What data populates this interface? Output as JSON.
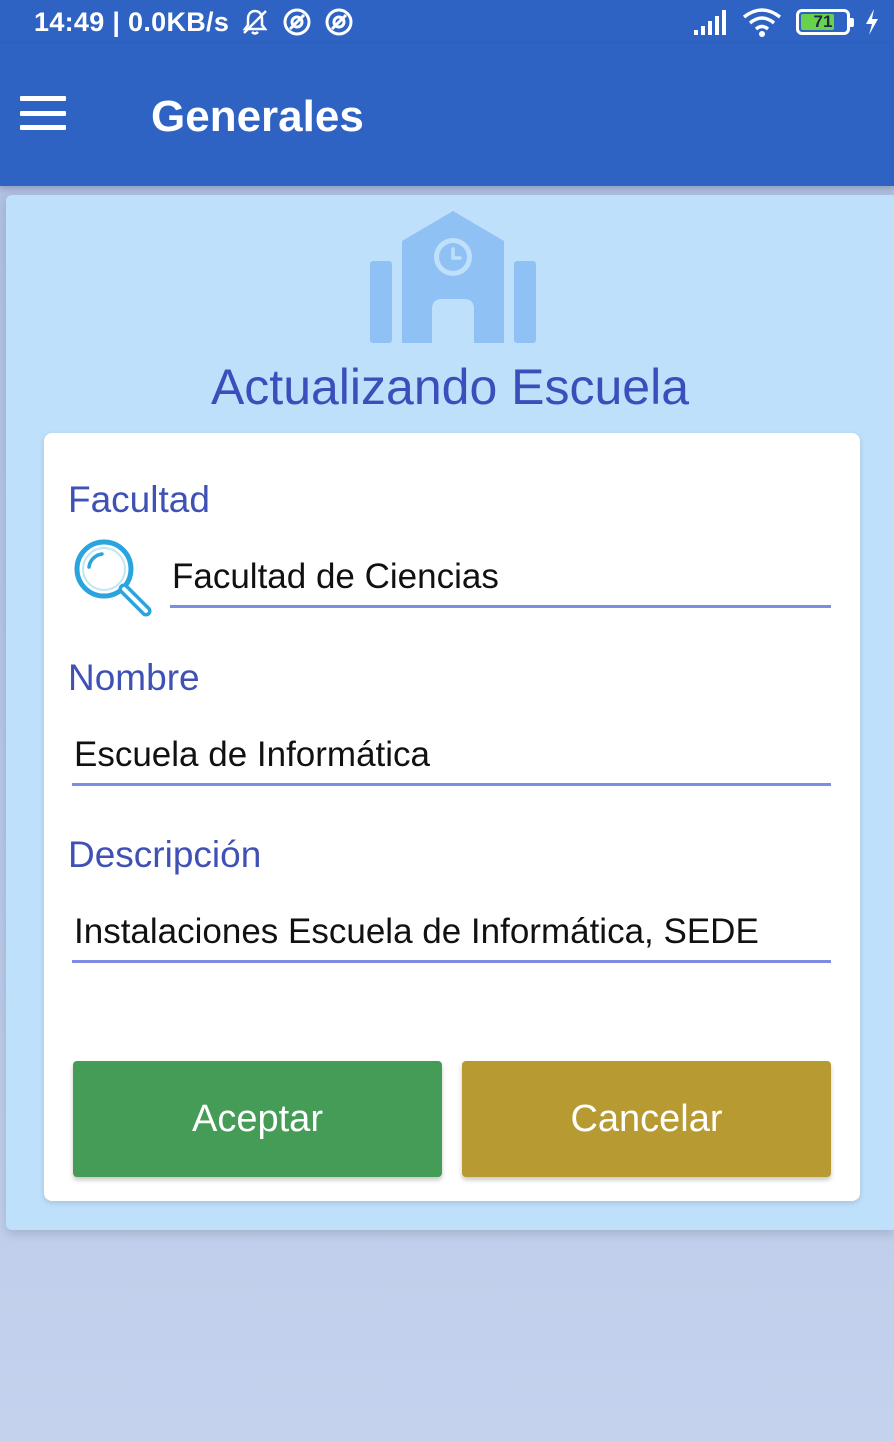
{
  "status_bar": {
    "time": "14:49 | 0.0KB/s",
    "battery_level": 71,
    "battery_text": "71",
    "icons": [
      "mute-bell-icon",
      "sync-icon",
      "sync-icon",
      "signal-icon",
      "wifi-icon",
      "battery-icon",
      "charging-icon"
    ]
  },
  "app_bar": {
    "title": "Generales",
    "menu_icon": "hamburger-menu-icon"
  },
  "panel": {
    "header_icon": "school-building-icon",
    "title": "Actualizando Escuela"
  },
  "form": {
    "facultad": {
      "label": "Facultad",
      "value": "Facultad de Ciencias",
      "icon": "search-icon"
    },
    "nombre": {
      "label": "Nombre",
      "value": "Escuela de Informática"
    },
    "descripcion": {
      "label": "Descripción",
      "value": "Instalaciones Escuela de Informática, SEDE"
    }
  },
  "buttons": {
    "accept_label": "Aceptar",
    "cancel_label": "Cancelar"
  },
  "colors": {
    "primary": "#2e63c3",
    "panel_bg": "#bfe0fb",
    "label": "#3f51b5",
    "underline": "#7f8ce6",
    "accept": "#459c56",
    "cancel": "#b89a32"
  }
}
